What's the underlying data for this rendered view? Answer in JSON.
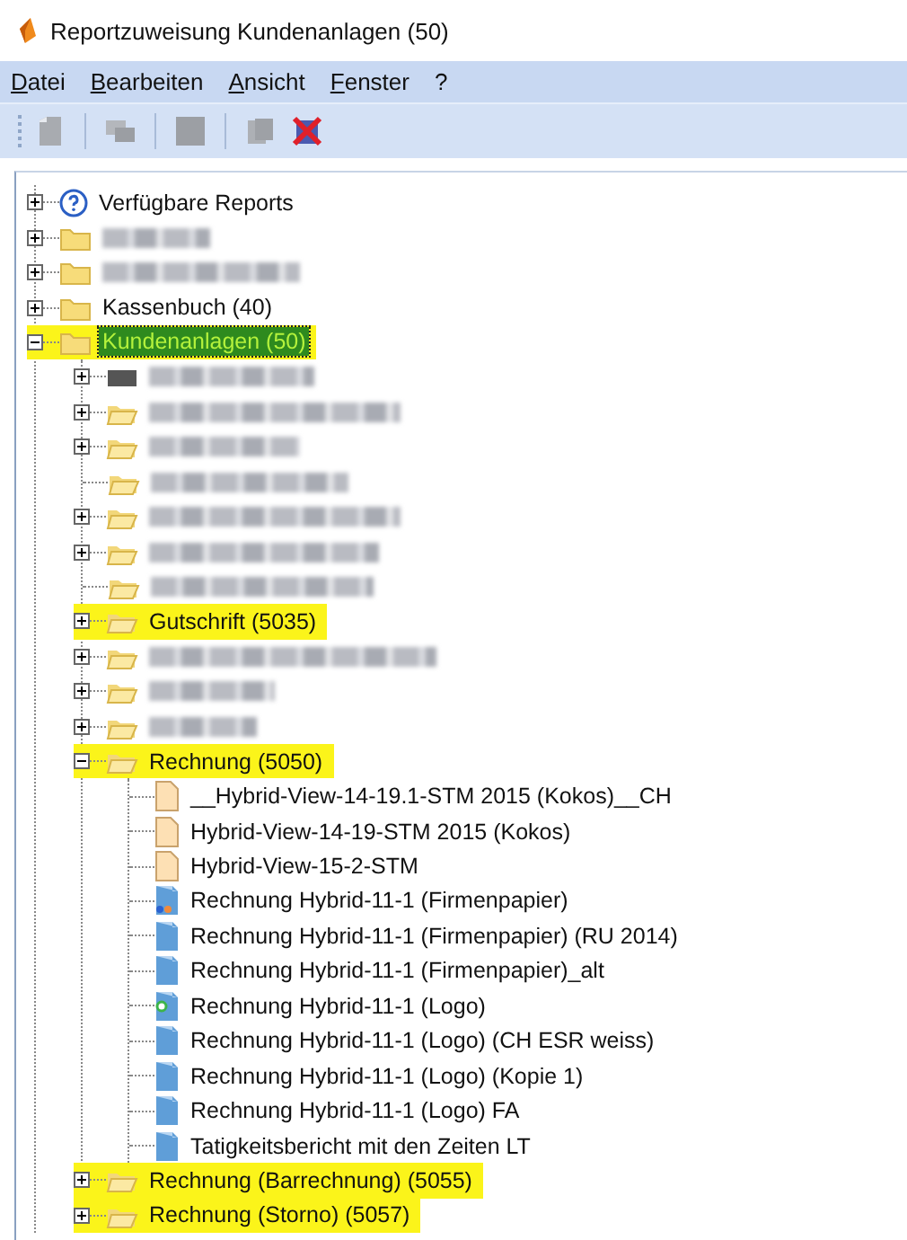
{
  "window": {
    "title": "Reportzuweisung Kundenanlagen (50)"
  },
  "menu": [
    "Datei",
    "Bearbeiten",
    "Ansicht",
    "Fenster",
    "?"
  ],
  "toolbar": [
    {
      "kind": "new",
      "disabled": true
    },
    {
      "kind": "separator"
    },
    {
      "kind": "copy",
      "disabled": true
    },
    {
      "kind": "separator"
    },
    {
      "kind": "block",
      "disabled": true
    },
    {
      "kind": "separator"
    },
    {
      "kind": "pages",
      "disabled": true
    },
    {
      "kind": "delete",
      "disabled": false
    }
  ],
  "tree": [
    {
      "label": "Verfügbare Reports",
      "kind": "help",
      "expanded": false,
      "highlighted": false,
      "selected": false
    },
    {
      "blurred": true,
      "kind": "folder",
      "expanded": false
    },
    {
      "blurred": true,
      "kind": "folder",
      "expanded": false
    },
    {
      "label": "Kassenbuch (40)",
      "kind": "folder",
      "expanded": false,
      "highlighted": false,
      "selected": false
    },
    {
      "label": "Kundenanlagen (50)",
      "kind": "folder",
      "expanded": true,
      "highlighted": true,
      "selected": true,
      "children": [
        {
          "blurred": true,
          "kind": "dark",
          "expanded": false
        },
        {
          "blurred": true,
          "kind": "open-folder",
          "expanded": false
        },
        {
          "blurred": true,
          "kind": "open-folder",
          "expanded": false
        },
        {
          "blurred": true,
          "kind": "open-folder"
        },
        {
          "blurred": true,
          "kind": "open-folder",
          "expanded": false
        },
        {
          "blurred": true,
          "kind": "open-folder",
          "expanded": false
        },
        {
          "blurred": true,
          "kind": "open-folder"
        },
        {
          "label": "Gutschrift (5035)",
          "kind": "open-folder",
          "expanded": false,
          "highlighted": true,
          "selected": false
        },
        {
          "blurred": true,
          "kind": "open-folder",
          "expanded": false
        },
        {
          "blurred": true,
          "kind": "open-folder",
          "expanded": false
        },
        {
          "blurred": true,
          "kind": "open-folder",
          "expanded": false
        },
        {
          "label": "Rechnung (5050)",
          "kind": "open-folder",
          "expanded": true,
          "highlighted": true,
          "selected": false,
          "children": [
            {
              "label": "__Hybrid-View-14-19.1-STM 2015 (Kokos)__CH",
              "kind": "page",
              "highlighted": false,
              "selected": false
            },
            {
              "label": "Hybrid-View-14-19-STM 2015 (Kokos)",
              "kind": "page",
              "highlighted": false,
              "selected": false
            },
            {
              "label": "Hybrid-View-15-2-STM",
              "kind": "page",
              "highlighted": false,
              "selected": false
            },
            {
              "label": "Rechnung Hybrid-11-1 (Firmenpapier)",
              "kind": "report-dots",
              "highlighted": false,
              "selected": false
            },
            {
              "label": "Rechnung Hybrid-11-1 (Firmenpapier) (RU 2014)",
              "kind": "report",
              "highlighted": false,
              "selected": false
            },
            {
              "label": "Rechnung Hybrid-11-1 (Firmenpapier)_alt",
              "kind": "report",
              "highlighted": false,
              "selected": false
            },
            {
              "label": "Rechnung Hybrid-11-1 (Logo)",
              "kind": "report-green",
              "highlighted": false,
              "selected": false
            },
            {
              "label": "Rechnung Hybrid-11-1 (Logo) (CH ESR weiss)",
              "kind": "report",
              "highlighted": false,
              "selected": false
            },
            {
              "label": "Rechnung Hybrid-11-1 (Logo) (Kopie 1)",
              "kind": "report",
              "highlighted": false,
              "selected": false
            },
            {
              "label": "Rechnung Hybrid-11-1 (Logo) FA",
              "kind": "report",
              "highlighted": false,
              "selected": false
            },
            {
              "label": "Tatigkeitsbericht mit den Zeiten LT",
              "kind": "report",
              "highlighted": false,
              "selected": false
            }
          ]
        },
        {
          "label": "Rechnung (Barrechnung) (5055)",
          "kind": "open-folder",
          "expanded": false,
          "highlighted": true,
          "selected": false
        },
        {
          "label": "Rechnung (Storno) (5057)",
          "kind": "open-folder",
          "expanded": false,
          "highlighted": true,
          "selected": false
        }
      ]
    }
  ]
}
